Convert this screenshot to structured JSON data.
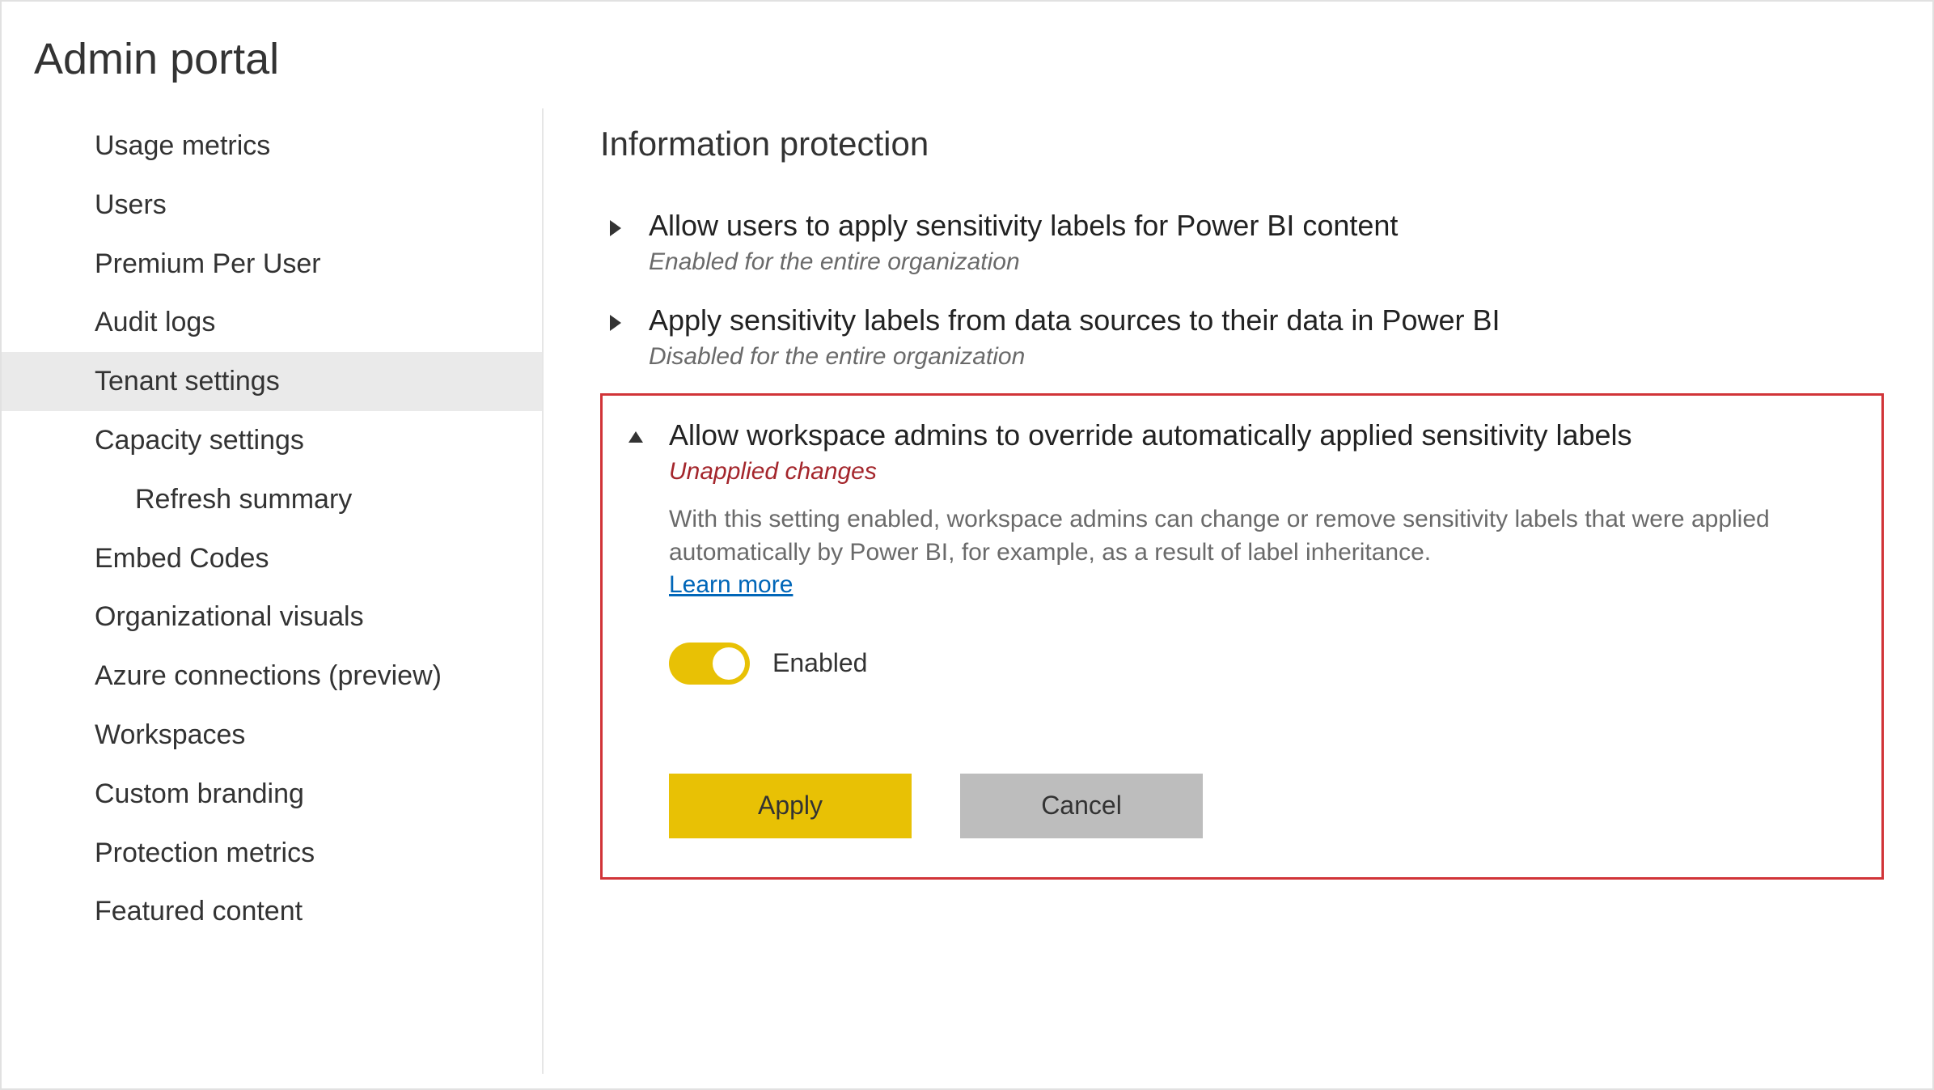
{
  "page_title": "Admin portal",
  "sidebar": {
    "items": [
      {
        "label": "Usage metrics",
        "active": false,
        "indent": false
      },
      {
        "label": "Users",
        "active": false,
        "indent": false
      },
      {
        "label": "Premium Per User",
        "active": false,
        "indent": false
      },
      {
        "label": "Audit logs",
        "active": false,
        "indent": false
      },
      {
        "label": "Tenant settings",
        "active": true,
        "indent": false
      },
      {
        "label": "Capacity settings",
        "active": false,
        "indent": false
      },
      {
        "label": "Refresh summary",
        "active": false,
        "indent": true
      },
      {
        "label": "Embed Codes",
        "active": false,
        "indent": false
      },
      {
        "label": "Organizational visuals",
        "active": false,
        "indent": false
      },
      {
        "label": "Azure connections (preview)",
        "active": false,
        "indent": false
      },
      {
        "label": "Workspaces",
        "active": false,
        "indent": false
      },
      {
        "label": "Custom branding",
        "active": false,
        "indent": false
      },
      {
        "label": "Protection metrics",
        "active": false,
        "indent": false
      },
      {
        "label": "Featured content",
        "active": false,
        "indent": false
      }
    ]
  },
  "main": {
    "section_heading": "Information protection",
    "settings": [
      {
        "expanded": false,
        "title": "Allow users to apply sensitivity labels for Power BI content",
        "status": "Enabled for the entire organization"
      },
      {
        "expanded": false,
        "title": "Apply sensitivity labels from data sources to their data in Power BI",
        "status": "Disabled for the entire organization"
      }
    ],
    "expanded_setting": {
      "title": "Allow workspace admins to override automatically applied sensitivity labels",
      "status": "Unapplied changes",
      "description": "With this setting enabled, workspace admins can change or remove sensitivity labels that were applied automatically by Power BI, for example, as a result of label inheritance.",
      "learn_more": "Learn more",
      "toggle_state": "Enabled",
      "apply_label": "Apply",
      "cancel_label": "Cancel"
    }
  }
}
